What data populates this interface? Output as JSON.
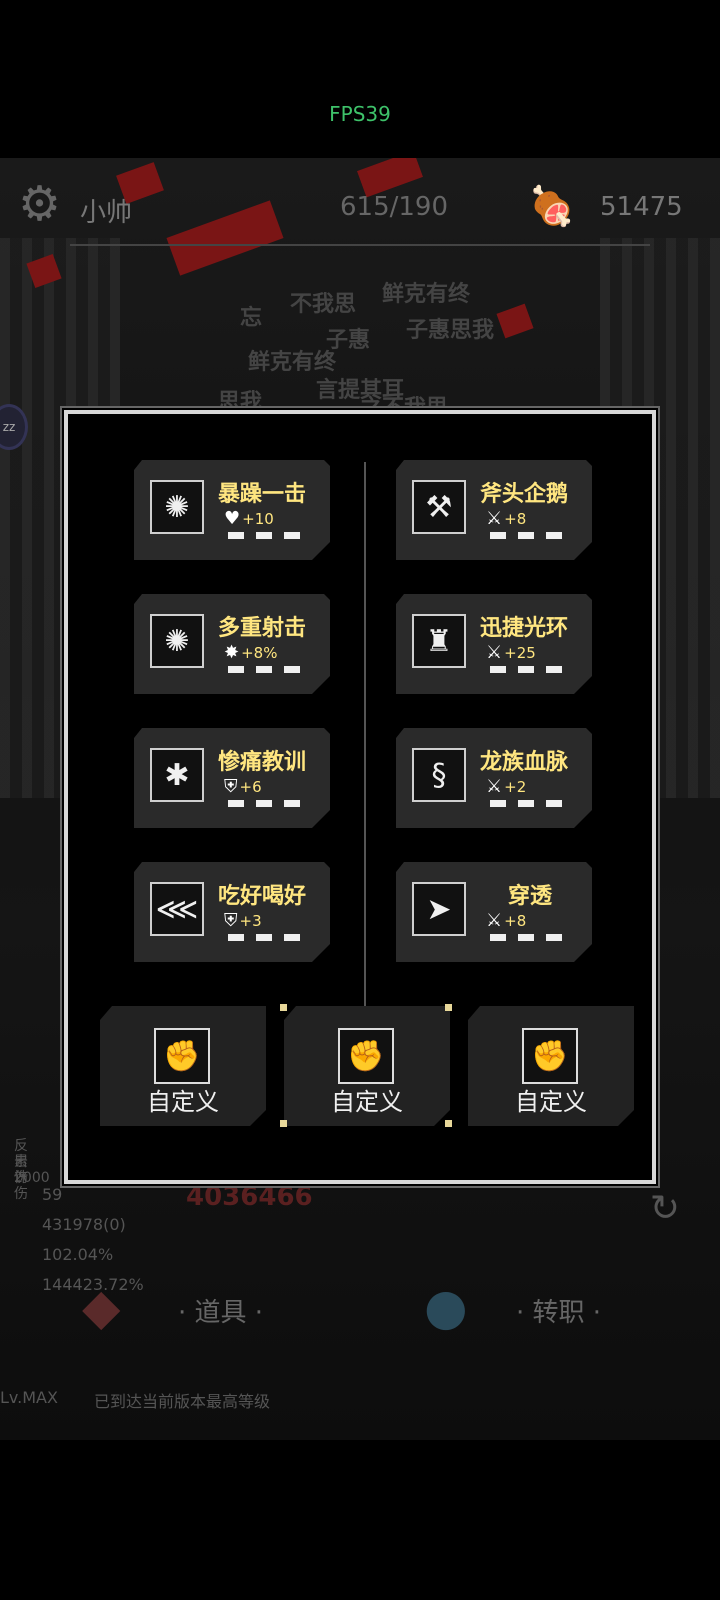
{
  "status": {
    "fps": "FPS39"
  },
  "hud": {
    "player_name": "小帅",
    "hp": "615/190",
    "gold": "51475",
    "settings_icon": "gear-icon",
    "currency_icon": "meat-icon"
  },
  "background_text": [
    "不我思",
    "鲜克有终",
    "忘",
    "子惠",
    "子惠思我",
    "鲜克有终",
    "言提其耳",
    "思我",
    "之不我思"
  ],
  "side_stats": [
    "反击伤",
    "累计伤",
    "2000",
    "59",
    "431978(0)",
    "102.04%",
    "144423.72%"
  ],
  "damage_number": "4036466",
  "bottom_nav": {
    "items": "· 道具 ·",
    "job": "· 转职 ·"
  },
  "footer": {
    "level": "Lv.MAX",
    "message": "已到达当前版本最高等级"
  },
  "dialog": {
    "skills_left": [
      {
        "name": "暴躁一击",
        "bonus": "+10",
        "bonus_icon": "heart-icon",
        "icon": "burst-icon"
      },
      {
        "name": "多重射击",
        "bonus": "+8%",
        "bonus_icon": "crit-icon",
        "icon": "burst-icon"
      },
      {
        "name": "惨痛教训",
        "bonus": "+6",
        "bonus_icon": "shield-icon",
        "icon": "shatter-icon"
      },
      {
        "name": "吃好喝好",
        "bonus": "+3",
        "bonus_icon": "shield-icon",
        "icon": "fishbone-icon"
      }
    ],
    "skills_right": [
      {
        "name": "斧头企鹅",
        "bonus": "+8",
        "bonus_icon": "sword-icon",
        "icon": "axe-icon"
      },
      {
        "name": "迅捷光环",
        "bonus": "+25",
        "bonus_icon": "sword-speed-icon",
        "icon": "strongman-icon"
      },
      {
        "name": "龙族血脉",
        "bonus": "+2",
        "bonus_icon": "sword-icon",
        "icon": "lizard-icon"
      },
      {
        "name": "穿透",
        "bonus": "+8",
        "bonus_icon": "sword-speed-icon",
        "icon": "arrowhead-icon"
      }
    ],
    "custom_slots": [
      "自定义",
      "自定义",
      "自定义"
    ]
  }
}
